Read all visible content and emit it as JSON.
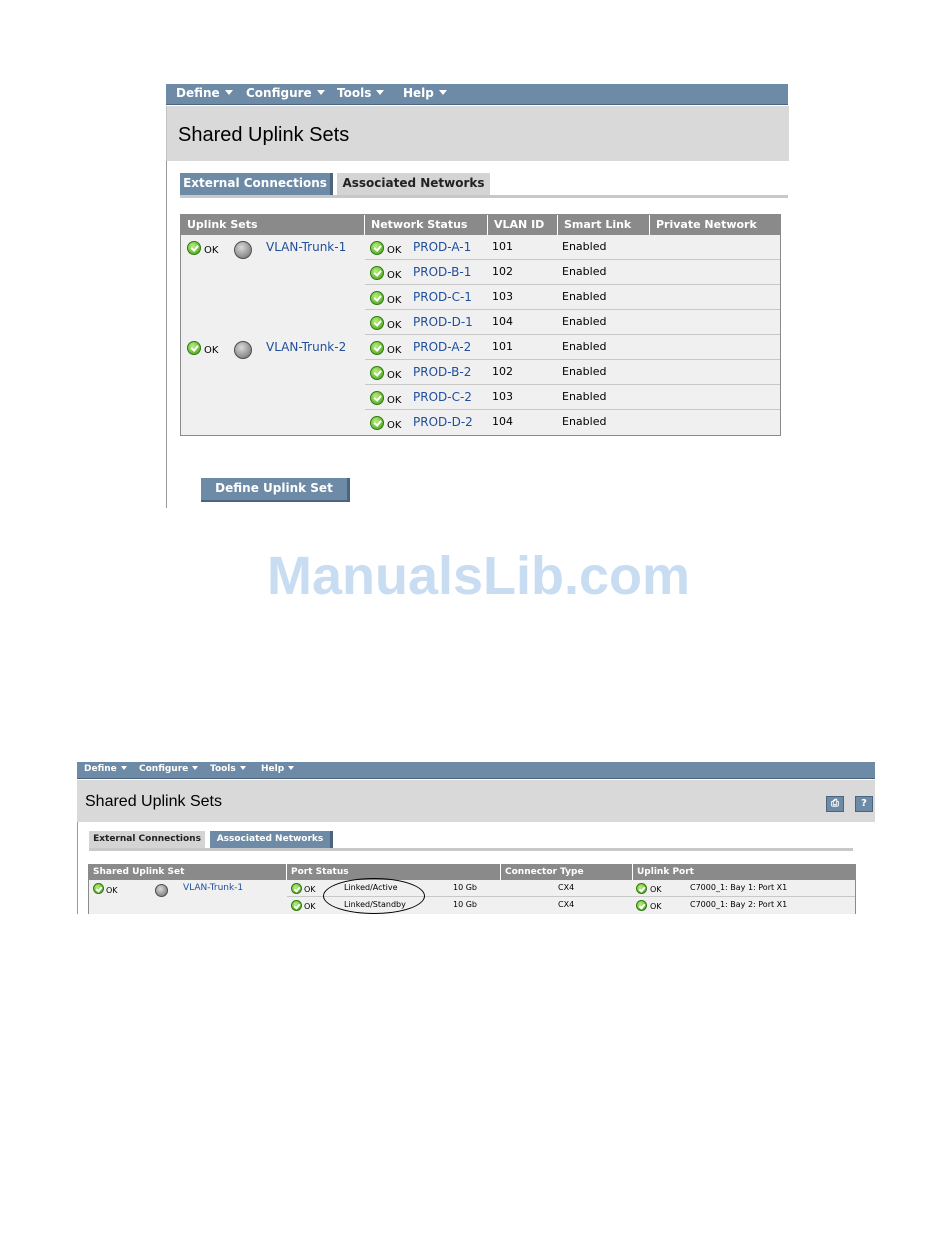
{
  "panel1": {
    "menu": [
      "Define",
      "Configure",
      "Tools",
      "Help"
    ],
    "title": "Shared Uplink Sets",
    "tabs": {
      "external": "External Connections",
      "associated": "Associated Networks"
    },
    "columns": [
      "Uplink Sets",
      "Network Status",
      "VLAN ID",
      "Smart Link",
      "Private Network"
    ],
    "groups": [
      {
        "status": "OK",
        "name": "VLAN-Trunk-1"
      },
      {
        "status": "OK",
        "name": "VLAN-Trunk-2"
      }
    ],
    "rows": [
      {
        "status": "OK",
        "network": "PROD-A-1",
        "vlan": "101",
        "smartlink": "Enabled"
      },
      {
        "status": "OK",
        "network": "PROD-B-1",
        "vlan": "102",
        "smartlink": "Enabled"
      },
      {
        "status": "OK",
        "network": "PROD-C-1",
        "vlan": "103",
        "smartlink": "Enabled"
      },
      {
        "status": "OK",
        "network": "PROD-D-1",
        "vlan": "104",
        "smartlink": "Enabled"
      },
      {
        "status": "OK",
        "network": "PROD-A-2",
        "vlan": "101",
        "smartlink": "Enabled"
      },
      {
        "status": "OK",
        "network": "PROD-B-2",
        "vlan": "102",
        "smartlink": "Enabled"
      },
      {
        "status": "OK",
        "network": "PROD-C-2",
        "vlan": "103",
        "smartlink": "Enabled"
      },
      {
        "status": "OK",
        "network": "PROD-D-2",
        "vlan": "104",
        "smartlink": "Enabled"
      }
    ],
    "button": "Define Uplink Set"
  },
  "watermark": "ManualsLib.com",
  "panel2": {
    "menu": [
      "Define",
      "Configure",
      "Tools",
      "Help"
    ],
    "title": "Shared Uplink Sets",
    "tabs": {
      "external": "External Connections",
      "associated": "Associated Networks"
    },
    "columns": [
      "Shared Uplink Set",
      "Port Status",
      "Connector Type",
      "Uplink Port"
    ],
    "group": {
      "status": "OK",
      "name": "VLAN-Trunk-1"
    },
    "rows": [
      {
        "status": "OK",
        "port_status": "Linked/Active",
        "speed": "10 Gb",
        "connector": "CX4",
        "uplink_status": "OK",
        "uplink_port": "C7000_1: Bay 1: Port X1"
      },
      {
        "status": "OK",
        "port_status": "Linked/Standby",
        "speed": "10 Gb",
        "connector": "CX4",
        "uplink_status": "OK",
        "uplink_port": "C7000_1: Bay 2: Port X1"
      }
    ]
  },
  "colors": {
    "menu_bar": "#6d8aa6",
    "header_bg": "#d9d9d9",
    "table_header": "#8a8a8a",
    "link": "#1f4e9a",
    "ok_green": "#3f9a16",
    "watermark": "#c8dcf2"
  }
}
